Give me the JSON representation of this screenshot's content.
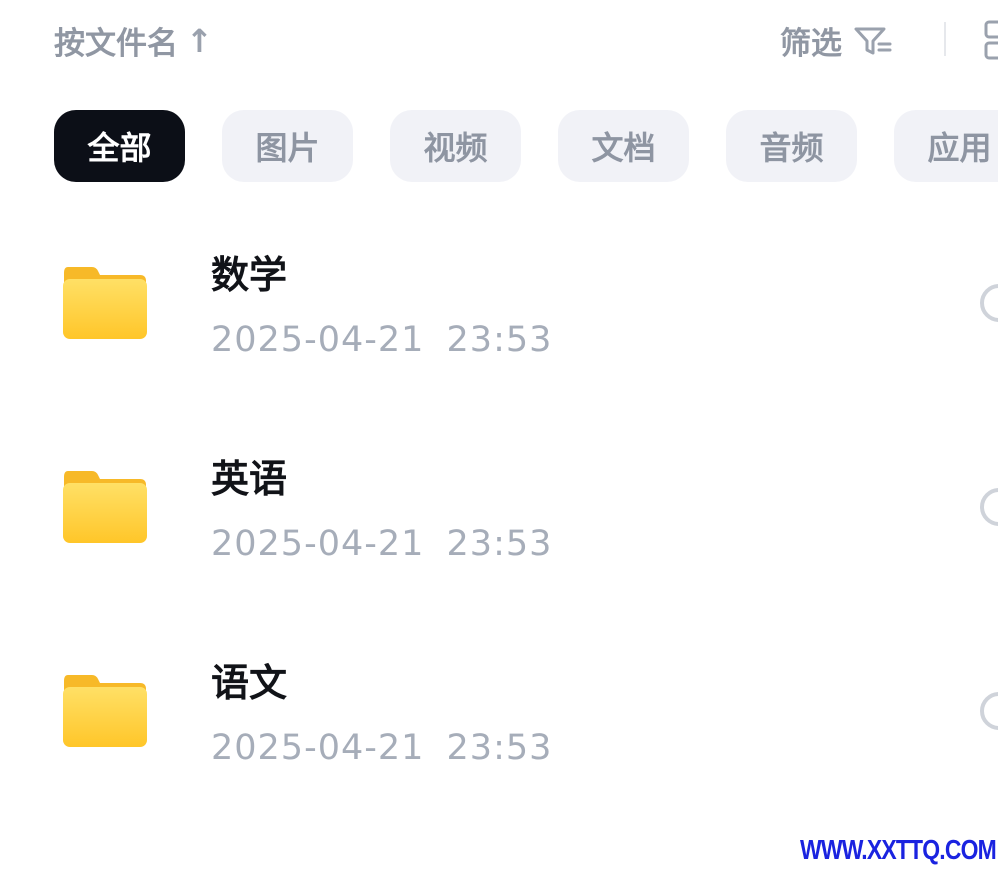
{
  "toolbar": {
    "sort_label": "按文件名",
    "sort_arrow": "↑",
    "filter_label": "筛选"
  },
  "categories": [
    {
      "label": "全部",
      "active": true
    },
    {
      "label": "图片",
      "active": false
    },
    {
      "label": "视频",
      "active": false
    },
    {
      "label": "文档",
      "active": false
    },
    {
      "label": "音频",
      "active": false
    },
    {
      "label": "应用",
      "active": false
    }
  ],
  "files": [
    {
      "name": "数学",
      "date": "2025-04-21  23:53",
      "icon": "folder-icon"
    },
    {
      "name": "英语",
      "date": "2025-04-21  23:53",
      "icon": "folder-icon"
    },
    {
      "name": "语文",
      "date": "2025-04-21  23:53",
      "icon": "folder-icon"
    }
  ],
  "watermark": "WWW.XXTTQ.COM",
  "colors": {
    "active_chip": "#0c0f17",
    "chip_bg": "#f1f2f7",
    "folder_yellow": "#ffd23f",
    "watermark_blue": "#1a23e0"
  }
}
